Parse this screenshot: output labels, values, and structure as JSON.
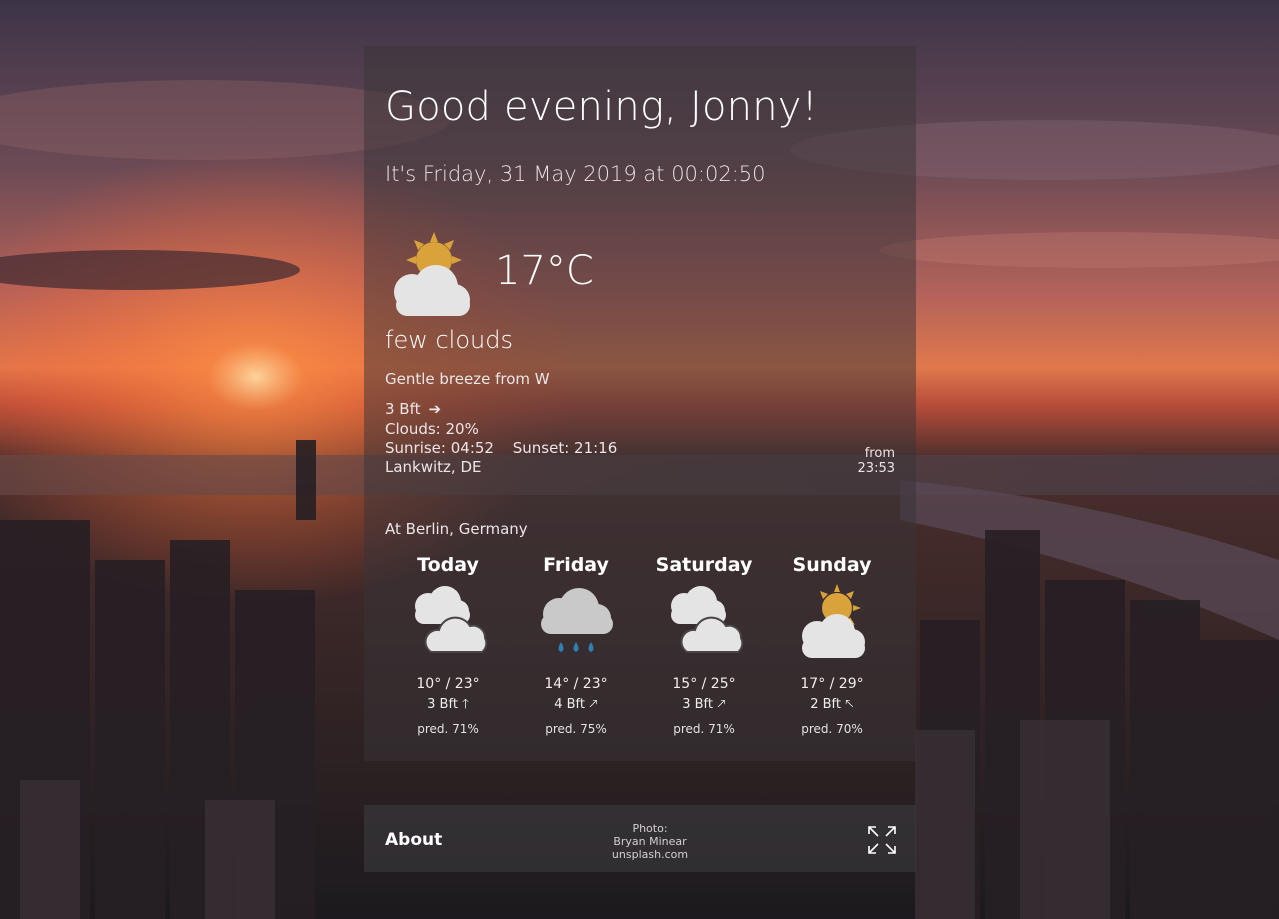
{
  "header": {
    "greeting": "Good evening, Jonny!",
    "datetime": "It's Friday, 31 May 2019 at 00:02:50"
  },
  "current": {
    "icon": "sun-behind-cloud-icon",
    "temperature": "17°C",
    "description": "few clouds",
    "wind_description": "Gentle breeze from W",
    "wind_bft": "3 Bft",
    "wind_arrow": "➔",
    "clouds": "Clouds: 20%",
    "sunrise": "Sunrise: 04:52",
    "sunset": "Sunset: 21:16",
    "location": "Lankwitz, DE",
    "updated_from": "from",
    "updated_time": "23:53"
  },
  "forecast": {
    "location": "At Berlin, Germany",
    "days": [
      {
        "name": "Today",
        "icon": "two-clouds-icon",
        "temps": "10° / 23°",
        "wind": "3 Bft",
        "arrow": "🡑",
        "pred": "pred. 71%"
      },
      {
        "name": "Friday",
        "icon": "rain-cloud-icon",
        "temps": "14° / 23°",
        "wind": "4 Bft",
        "arrow": "🡕",
        "pred": "pred. 75%"
      },
      {
        "name": "Saturday",
        "icon": "two-clouds-icon",
        "temps": "15° / 25°",
        "wind": "3 Bft",
        "arrow": "🡕",
        "pred": "pred. 71%"
      },
      {
        "name": "Sunday",
        "icon": "sun-behind-cloud-icon",
        "temps": "17° / 29°",
        "wind": "2 Bft",
        "arrow": "🡔",
        "pred": "pred. 70%"
      }
    ]
  },
  "footer": {
    "about": "About",
    "photo_label": "Photo:",
    "photographer": "Bryan Minear",
    "source": "unsplash.com",
    "fullscreen_icon": "expand-icon"
  },
  "colors": {
    "sun": "#d9a23a",
    "cloud": "#e4e4e4",
    "rain_cloud": "#c9c9c9",
    "rain_drop": "#2f7fb0"
  }
}
